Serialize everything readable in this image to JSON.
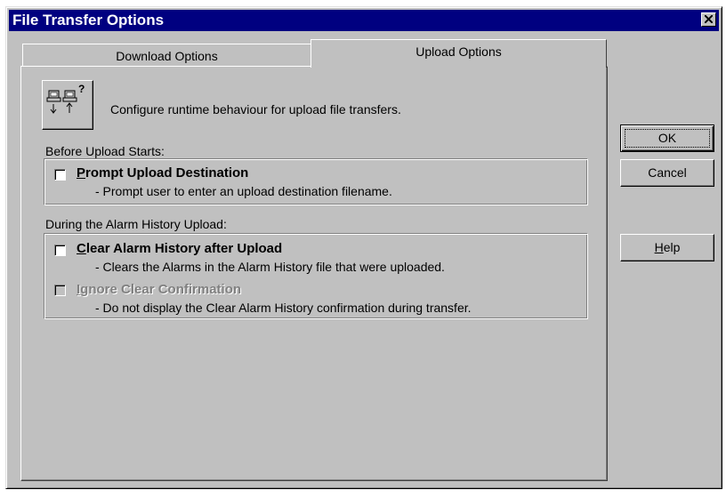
{
  "window": {
    "title": "File Transfer Options"
  },
  "tabs": [
    {
      "label": "Download Options",
      "active": false
    },
    {
      "label": "Upload Options",
      "active": true
    }
  ],
  "panel": {
    "description": "Configure runtime behaviour for upload file transfers.",
    "icon": "upload-transfer-icon",
    "sections": [
      {
        "label": "Before Upload Starts:",
        "options": [
          {
            "label_mnemonic": "P",
            "label_rest": "rompt Upload Destination",
            "description": "- Prompt user to enter an upload destination filename.",
            "checked": false,
            "enabled": true
          }
        ]
      },
      {
        "label": "During the Alarm History Upload:",
        "options": [
          {
            "label_mnemonic": "C",
            "label_rest": "lear Alarm History after Upload",
            "description": "- Clears the Alarms in the Alarm History file that were uploaded.",
            "checked": false,
            "enabled": true
          },
          {
            "label_mnemonic": "I",
            "label_rest": "gnore Clear Confirmation",
            "description": "- Do not display the Clear Alarm History confirmation during transfer.",
            "checked": false,
            "enabled": false
          }
        ]
      }
    ]
  },
  "buttons": {
    "ok": "OK",
    "cancel": "Cancel",
    "help_mnemonic": "H",
    "help_rest": "elp"
  },
  "colors": {
    "titlebar": "#000080",
    "face": "#c0c0c0"
  }
}
